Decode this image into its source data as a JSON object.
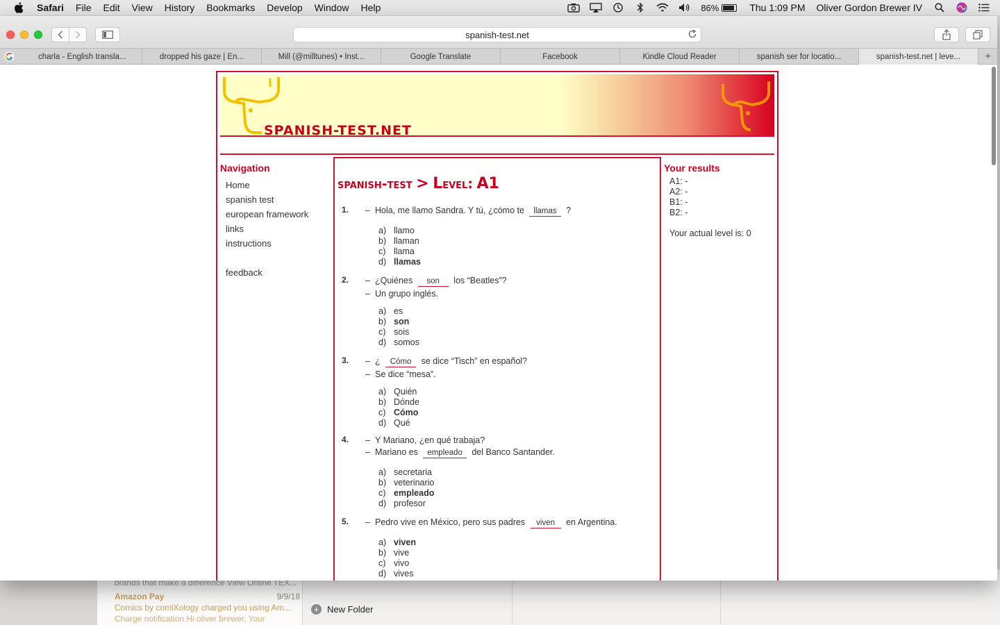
{
  "menubar": {
    "app": "Safari",
    "items": [
      "File",
      "Edit",
      "View",
      "History",
      "Bookmarks",
      "Develop",
      "Window",
      "Help"
    ],
    "battery": "86%",
    "clock": "Thu 1:09 PM",
    "user": "Oliver Gordon Brewer IV"
  },
  "browser": {
    "url": "spanish-test.net",
    "tabs": [
      "charla - English transla...",
      "dropped his gaze | En...",
      "Mill (@milltunes) • Inst...",
      "Google Translate",
      "Facebook",
      "Kindle Cloud Reader",
      "spanish ser for locatio...",
      "spanish-test.net | leve..."
    ]
  },
  "site": {
    "title": "SPANISH-TEST.NET",
    "nav_heading": "Navigation",
    "nav": [
      "Home",
      "spanish test",
      "european framework",
      "links",
      "instructions",
      "feedback"
    ],
    "heading_prefix": "spanish-test",
    "heading_arrow": ">",
    "heading_level_L": "L",
    "heading_level_rest": "evel:",
    "heading_code": "A1",
    "results_heading": "Your results",
    "results": [
      "A1: -",
      "A2: -",
      "B1: -",
      "B2: -"
    ],
    "actual_level": "Your actual level is: 0"
  },
  "questions": [
    {
      "num": "1.",
      "line1_pre": "Hola, me llamo Sandra. Y tú, ¿cómo te",
      "line1_blank": "llamas",
      "line1_post": "?",
      "options": [
        [
          "a)",
          "llamo"
        ],
        [
          "b)",
          "llaman"
        ],
        [
          "c)",
          "llama"
        ],
        [
          "d)",
          "llamas"
        ]
      ]
    },
    {
      "num": "2.",
      "line1_pre": "¿Quiénes",
      "line1_blank": "son",
      "line1_post": "los “Beatles”?",
      "line2": "Un grupo inglés.",
      "options": [
        [
          "a)",
          "es"
        ],
        [
          "b)",
          "son"
        ],
        [
          "c)",
          "sois"
        ],
        [
          "d)",
          "somos"
        ]
      ]
    },
    {
      "num": "3.",
      "line1_pre": "¿",
      "line1_blank": "Cómo",
      "line1_post": "se dice “Tisch” en español?",
      "line2": "Se dice “mesa”.",
      "options": [
        [
          "a)",
          "Quién"
        ],
        [
          "b)",
          "Dónde"
        ],
        [
          "c)",
          "Cómo"
        ],
        [
          "d)",
          "Qué"
        ]
      ]
    },
    {
      "num": "4.",
      "line1": "Y Mariano, ¿en qué trabaja?",
      "line2_pre": "Mariano es",
      "line2_blank": "empleado",
      "line2_post": "del Banco Santander.",
      "options": [
        [
          "a)",
          "secretaria"
        ],
        [
          "b)",
          "veterinario"
        ],
        [
          "c)",
          "empleado"
        ],
        [
          "d)",
          "profesor"
        ]
      ]
    },
    {
      "num": "5.",
      "line1_pre": "Pedro vive en México, pero sus padres",
      "line1_blank": "viven",
      "line1_post": "en Argentina.",
      "options": [
        [
          "a)",
          "viven"
        ],
        [
          "b)",
          "vive"
        ],
        [
          "c)",
          "vivo"
        ],
        [
          "d)",
          "vives"
        ]
      ]
    }
  ],
  "background_mail": {
    "preview_top": "brands that make a difference View Online TEX...",
    "from": "Amazon Pay",
    "date": "9/9/18",
    "subject": "Comics by comiXology charged you using Am...",
    "snippet": "Charge notification Hi oliver brewer, Your",
    "new_folder": "New Folder"
  }
}
